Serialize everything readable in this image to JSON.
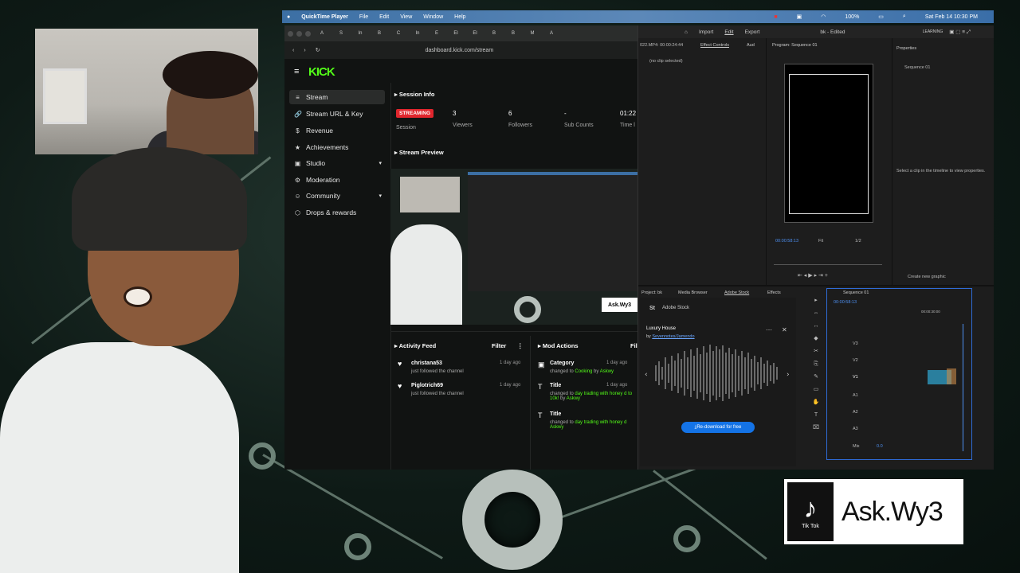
{
  "menubar": {
    "apple": "",
    "app": "QuickTime Player",
    "items": [
      "File",
      "Edit",
      "View",
      "Window",
      "Help"
    ],
    "battery": "100%",
    "clock": "Sat Feb 14 10:30 PM"
  },
  "browser": {
    "url": "dashboard.kick.com/stream",
    "tabs": [
      "A",
      "S",
      "In",
      "B",
      "C",
      "In",
      "E",
      "El",
      "El",
      "B",
      "B",
      "M",
      "A"
    ]
  },
  "kick": {
    "logo": "KICK",
    "sidebar": [
      {
        "label": "Stream",
        "icon": "≡"
      },
      {
        "label": "Stream URL & Key",
        "icon": "🔗"
      },
      {
        "label": "Revenue",
        "icon": "$"
      },
      {
        "label": "Achievements",
        "icon": "★"
      },
      {
        "label": "Studio",
        "icon": "▣"
      },
      {
        "label": "Moderation",
        "icon": "⚙"
      },
      {
        "label": "Community",
        "icon": "☺"
      },
      {
        "label": "Drops & rewards",
        "icon": "⬡"
      }
    ],
    "session": {
      "title": "Session Info",
      "badge": "STREAMING",
      "session_label": "Session",
      "viewers_value": "3",
      "viewers_label": "Viewers",
      "followers_value": "6",
      "followers_label": "Followers",
      "subs_value": "-",
      "subs_label": "Sub Counts",
      "time_value": "01:22",
      "time_label": "Time l"
    },
    "preview_title": "Stream Preview",
    "activity": {
      "title": "Activity Feed",
      "filter": "Filter",
      "items": [
        {
          "name": "christana53",
          "desc": "just followed the channel",
          "time": "1 day ago"
        },
        {
          "name": "Piglotrich69",
          "desc": "just followed the channel",
          "time": "1 day ago"
        }
      ]
    },
    "mod": {
      "title": "Mod Actions",
      "filter": "Fil",
      "items": [
        {
          "title": "Category",
          "prefix": "changed to ",
          "value": "Cooking",
          "by": " by ",
          "user": "Askwy",
          "time": "1 day ago"
        },
        {
          "title": "Title",
          "prefix": "changed to ",
          "value": "day trading with honey d to 10k!",
          "by": " by ",
          "user": "Askwy",
          "time": "1 day ago"
        },
        {
          "title": "Title",
          "prefix": "changed to ",
          "value": "day trading with honey d",
          "by": "",
          "user": "Askwy",
          "time": ""
        }
      ]
    }
  },
  "premiere": {
    "menu": [
      "Import",
      "Edit",
      "Export"
    ],
    "filename": "bk - Edited",
    "learning": "LEARNING",
    "source_timecode": "022.MP4: 00:00:24:44",
    "effect_controls": "Effect Controls",
    "aud": "Aud",
    "no_clip": "(no clip selected)",
    "program_title": "Program: Sequence 01",
    "properties": "Properties",
    "sequence": "Sequence 01",
    "select_clip": "Select a clip in the timeline to view properties.",
    "program_timecode": "00:00:58:13",
    "fit": "Fit",
    "ratio": "1/2",
    "create_graphic": "Create new graphic",
    "bottom_tabs": [
      "Project: bk",
      "Media Browser",
      "Adobe Stock",
      "Effects"
    ],
    "stock_logo": "St",
    "stock_title": "Adobe Stock",
    "track_name": "Luxury House",
    "track_by": "by ",
    "track_author": "Sevennotes/Jamendo",
    "download": "Re-download for free",
    "timeline_title": "Sequence 01",
    "timeline_tc": "00:00:58:13",
    "timeline_ruler": "00:00:30:00",
    "tracks": [
      "V3",
      "V2",
      "V1",
      "A1",
      "A2",
      "A3",
      "Mix"
    ],
    "mix_value": "0.0"
  },
  "overlay": {
    "tiktok_label": "Tik Tok",
    "handle": "Ask.Wy3"
  },
  "colors": {
    "kick_green": "#53fc18",
    "streaming_red": "#e0262d",
    "premiere_blue": "#1473e6"
  }
}
